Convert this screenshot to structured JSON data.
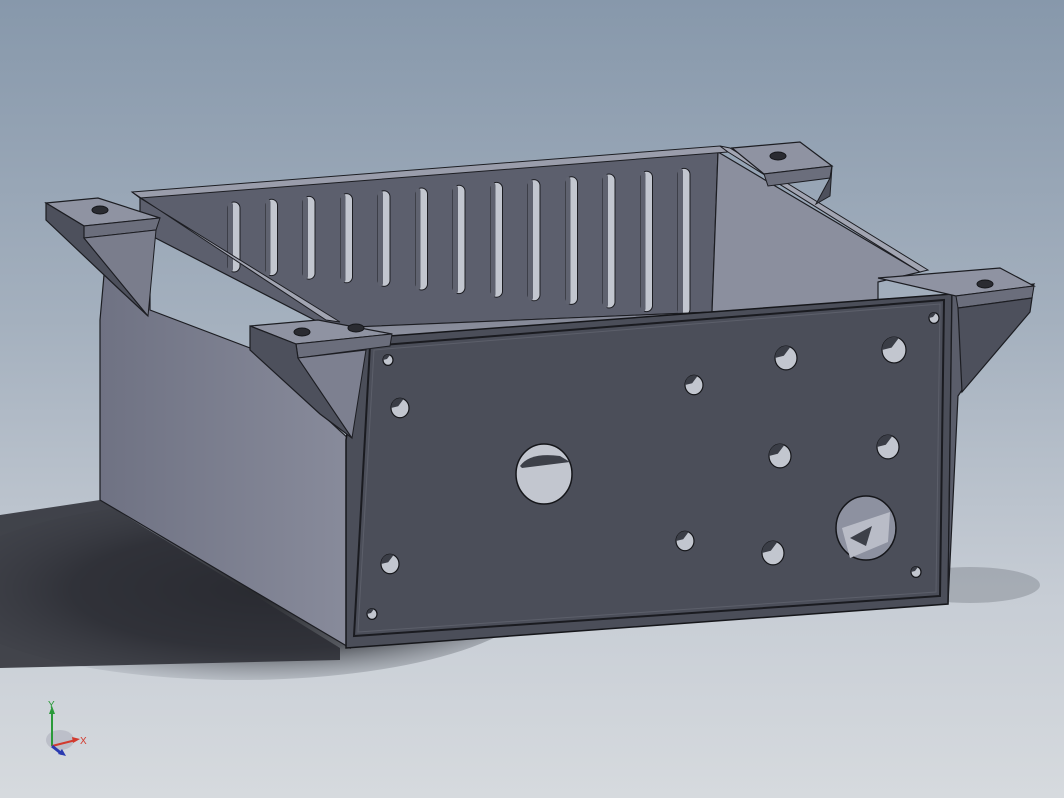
{
  "viewport": {
    "background_top": "#8798ab",
    "background_bottom": "#d6dade"
  },
  "model": {
    "name": "",
    "face_colors": {
      "front_plate": "#4b4e59",
      "left_side": "#7e8191",
      "right_side": "#6d7080",
      "back_wall": "#5c5f6d",
      "floor": "#8a8e9c",
      "top_rim": "#9a9dab",
      "bracket_top": "#8f93a2",
      "bracket_side": "#4d505c",
      "edge": "#1c1d22",
      "slot": "#c2c6cf",
      "shadow": "#25272c"
    },
    "slot_count": 13,
    "front_hole_count": 16
  },
  "triad": {
    "x_label": "X",
    "y_label": "Y",
    "x_color": "#d23a2e",
    "y_color": "#2a9a3a",
    "z_color": "#2a3ab0",
    "icon": "coordinate-triad-icon"
  }
}
